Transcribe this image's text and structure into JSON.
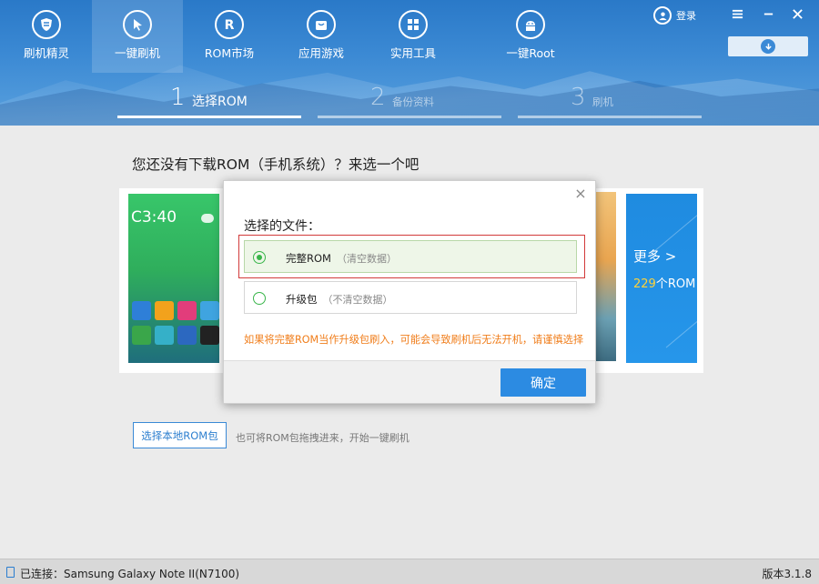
{
  "nav": {
    "items": [
      {
        "label": "刷机精灵",
        "icon": "shield-icon"
      },
      {
        "label": "一键刷机",
        "icon": "cursor-icon"
      },
      {
        "label": "ROM市场",
        "icon": "rom-r-icon"
      },
      {
        "label": "应用游戏",
        "icon": "bag-icon"
      },
      {
        "label": "实用工具",
        "icon": "grid-icon"
      },
      {
        "label": "一键Root",
        "icon": "android-icon"
      }
    ],
    "active_index": 1
  },
  "header": {
    "login_label": "登录"
  },
  "steps": [
    {
      "num": "1",
      "label": "选择ROM"
    },
    {
      "num": "2",
      "label": "备份资料"
    },
    {
      "num": "3",
      "label": "刷机"
    }
  ],
  "main": {
    "heading": "您还没有下载ROM（手机系统）？来选一个吧",
    "preview_time": "C3:40",
    "more_label": "更多 >",
    "more_count": "229",
    "more_count_suffix": "个ROM",
    "local_rom_button": "选择本地ROM包",
    "drag_hint": "也可将ROM包拖拽进来，开始一键刷机"
  },
  "modal": {
    "title": "选择的文件：",
    "options": [
      {
        "name": "完整ROM",
        "note": "（清空数据）",
        "selected": true
      },
      {
        "name": "升级包",
        "note": "（不清空数据）",
        "selected": false
      }
    ],
    "warning": "如果将完整ROM当作升级包刷入，可能会导致刷机后无法开机，请谨慎选择",
    "confirm_label": "确定",
    "close_symbol": "×"
  },
  "status": {
    "connection": "已连接：Samsung Galaxy Note II(N7100)",
    "version": "版本3.1.8"
  },
  "colors": {
    "accent": "#2c8be2",
    "radio_green": "#39b54a",
    "warning_orange": "#f07d1a",
    "highlight_red": "#d23a3a"
  }
}
